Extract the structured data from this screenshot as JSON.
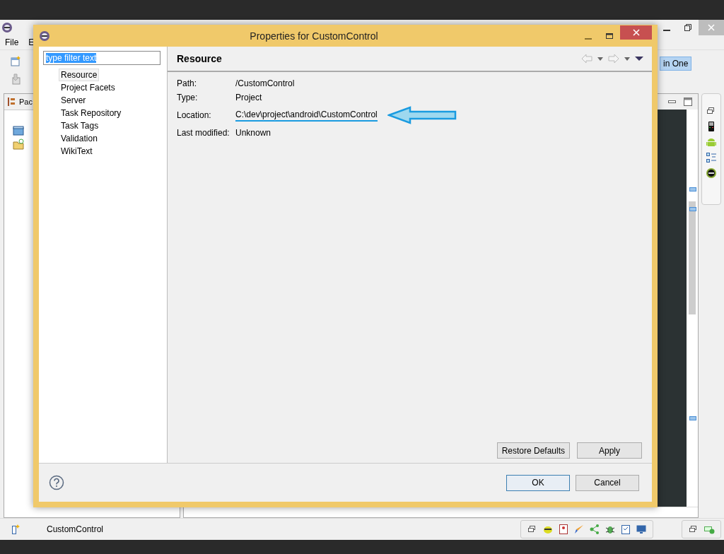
{
  "ide": {
    "menu": [
      "File",
      "E"
    ],
    "toolbar_button": "in One",
    "view_tab": "Pac",
    "status_text": "CustomControl"
  },
  "dialog": {
    "title": "Properties for CustomControl",
    "filter": {
      "value": "type filter text"
    },
    "nav": [
      {
        "label": "Resource",
        "selected": true
      },
      {
        "label": "Project Facets",
        "selected": false
      },
      {
        "label": "Server",
        "selected": false
      },
      {
        "label": "Task Repository",
        "selected": false
      },
      {
        "label": "Task Tags",
        "selected": false
      },
      {
        "label": "Validation",
        "selected": false
      },
      {
        "label": "WikiText",
        "selected": false
      }
    ],
    "page_title": "Resource",
    "properties": [
      {
        "label": "Path:",
        "value": "/CustomControl",
        "highlighted": false
      },
      {
        "label": "Type:",
        "value": "Project",
        "highlighted": false
      },
      {
        "label": "Location:",
        "value": "C:\\dev\\project\\android\\CustomControl",
        "highlighted": true
      },
      {
        "label": "Last modified:",
        "value": "Unknown",
        "highlighted": false
      }
    ],
    "page_buttons": [
      "Restore Defaults",
      "Apply"
    ],
    "buttons": [
      {
        "label": "OK",
        "default": true
      },
      {
        "label": "Cancel",
        "default": false
      }
    ]
  }
}
